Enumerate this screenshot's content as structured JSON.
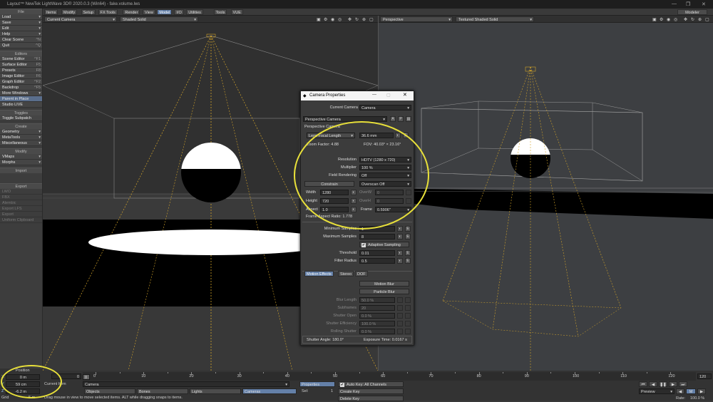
{
  "window": {
    "title": "Layout™ NewTek LightWave 3D® 2020.0.3 (Win64) - fake.volume.lws"
  },
  "left_panel": {
    "file_header": "File",
    "file_items": [
      {
        "label": "Load",
        "kind": "dd"
      },
      {
        "label": "Save",
        "kind": "dd"
      },
      {
        "label": "Edit",
        "kind": "dd"
      },
      {
        "label": "Help",
        "kind": "dd"
      },
      {
        "label": "Clear Scene",
        "shortcut": "^N"
      },
      {
        "label": "Quit",
        "shortcut": "^Q"
      }
    ],
    "editors_header": "Editors",
    "editors_items": [
      {
        "label": "Scene Editor",
        "shortcut": "^F1"
      },
      {
        "label": "Surface Editor",
        "shortcut": "F5"
      },
      {
        "label": "Presets",
        "shortcut": "F8"
      },
      {
        "label": "Image Editor",
        "shortcut": "F6"
      },
      {
        "label": "Graph Editor",
        "shortcut": "^F2"
      },
      {
        "label": "Backdrop",
        "shortcut": "^F5"
      },
      {
        "label": "More Windows",
        "kind": "dd"
      },
      {
        "label": "Parent in Place",
        "selected": true
      },
      {
        "label": "Studio LIVE"
      }
    ],
    "toggles_header": "Toggles",
    "toggles_items": [
      {
        "label": "Toggle Subpatch"
      }
    ],
    "create_header": "Create",
    "create_items": [
      {
        "label": "Geometry",
        "kind": "dd"
      },
      {
        "label": "MetaTools",
        "kind": "dd"
      },
      {
        "label": "Miscellaneous",
        "kind": "dd"
      }
    ],
    "modify_header": "Modify",
    "modify_items": [
      {
        "label": "VMaps",
        "kind": "dd"
      },
      {
        "label": "Morphs",
        "kind": "dd"
      }
    ],
    "import_header": "Import",
    "export_header": "Export",
    "export_items": [
      "LWO",
      "FBX",
      "Alembic",
      "Export LFS",
      "Export",
      "Uniform Clipboard"
    ]
  },
  "menubar": {
    "tabs": [
      "Items",
      "Modify",
      "Setup",
      "FX Tools",
      "Render",
      "View",
      "Model",
      "I/O",
      "Utilities",
      "Tools",
      "VUE"
    ],
    "active": "Model",
    "modeler": "Modeler"
  },
  "viewport_left": {
    "view": "Current Camera",
    "shading": "Shaded Solid"
  },
  "viewport_right": {
    "view": "Perspective",
    "shading": "Textured Shaded Solid"
  },
  "dialog": {
    "title": "Camera Properties",
    "current_camera_label": "Current Camera",
    "current_camera_value": "Camera",
    "camera_type": "Perspective Camera",
    "section": "Perspective Camera",
    "lens_mode": "Lens Focal Length",
    "lens_value": "36.6 mm",
    "zoom_factor": "Zoom Factor: 4.88",
    "fov": "FOV: 40.03° × 23.16°",
    "resolution_label": "Resolution",
    "resolution_value": "HDTV (1280 x 720)",
    "multiplier_label": "Multiplier",
    "multiplier_value": "100 %",
    "field_rendering_label": "Field Rendering",
    "field_rendering_value": "Off",
    "constrain_label": "Constrain",
    "overscan_value": "Overscan Off",
    "width_label": "Width",
    "width_value": "1280",
    "height_label": "Height",
    "height_value": "720",
    "aspect_label": "Aspect",
    "aspect_value": "1.0",
    "overw_label": "OverW",
    "overw_value": "0",
    "overh_label": "OverH",
    "overh_value": "0",
    "frame_label": "Frame",
    "frame_value": "0.5906\"",
    "frame_aspect": "Frame Aspect Ratio: 1.778",
    "min_samples_label": "Minimum Samples",
    "min_samples_value": "1",
    "max_samples_label": "Maximum Samples",
    "max_samples_value": "8",
    "adaptive_label": "Adaptive Sampling",
    "threshold_label": "Threshold",
    "threshold_value": "0.01",
    "filter_radius_label": "Filter Radius",
    "filter_radius_value": "0.5",
    "tabs": [
      "Motion Effects",
      "Stereo",
      "DOF"
    ],
    "motion_blur_label": "Motion Blur",
    "particle_blur_label": "Particle Blur",
    "blur_length_label": "Blur Length",
    "blur_length_value": "50.0 %",
    "subframes_label": "Subframes",
    "subframes_value": "20",
    "shutter_open_label": "Shutter Open",
    "shutter_open_value": "0.0 %",
    "shutter_eff_label": "Shutter Efficiency",
    "shutter_eff_value": "100.0 %",
    "rolling_label": "Rolling Shutter",
    "rolling_value": "0.0 %",
    "shutter_angle": "Shutter Angle: 180.0°",
    "exposure_time": "Exposure Time: 0.0167 s"
  },
  "bottom": {
    "position_label": "Position",
    "x_label": "X",
    "x_value": "0 m",
    "y_label": "Y",
    "y_value": "59 cm",
    "z_label": "Z",
    "z_value": "-6.2 m",
    "grid_label": "Grid",
    "grid_value": "5 m",
    "current_item_label": "Current Item",
    "current_item_value": "Camera",
    "timeline_ticks": [
      "0",
      "10",
      "20",
      "30",
      "40",
      "50",
      "60",
      "70",
      "80",
      "90",
      "100",
      "110",
      "120"
    ],
    "timeline_start": "0",
    "timeline_end": "120",
    "frame_field": "0",
    "end_field": "120",
    "objects_label": "Objects",
    "bones_label": "Bones",
    "lights_label": "Lights",
    "cameras_label": "Cameras",
    "properties_label": "Properties",
    "sel_label": "Sel:",
    "sel_value": "1",
    "autokey_label": "Auto Key: All Channels",
    "create_key": "Create Key",
    "delete_key": "Delete Key",
    "preview_label": "Preview",
    "rate_label": "Rate:",
    "rate_value": "100.0 %",
    "status": "Drag mouse in view to move selected items. ALT while dragging snaps to items."
  }
}
